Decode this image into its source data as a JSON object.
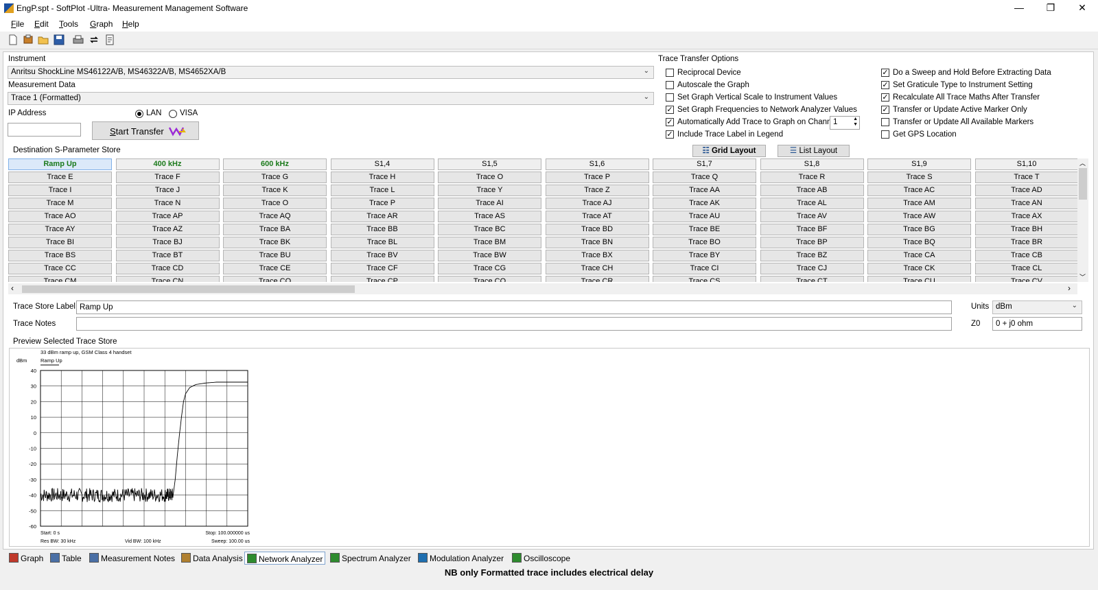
{
  "window": {
    "title": "EngP.spt - SoftPlot -Ultra- Measurement Management Software",
    "min": "—",
    "max": "❐",
    "close": "✕"
  },
  "menu": [
    {
      "u": "F",
      "rest": "ile"
    },
    {
      "u": "E",
      "rest": "dit"
    },
    {
      "u": "T",
      "rest": "ools"
    },
    {
      "u": "G",
      "rest": "raph"
    },
    {
      "u": "H",
      "rest": "elp"
    }
  ],
  "toolbar_icons": [
    "new-icon",
    "open-icon",
    "folder-icon",
    "save-icon",
    "print-icon",
    "refresh-icon",
    "script-icon"
  ],
  "instrument": {
    "label": "Instrument",
    "value": "Anritsu ShockLine MS46122A/B, MS46322A/B, MS4652XA/B",
    "measurement_label": "Measurement Data",
    "measurement_value": "Trace 1 (Formatted)",
    "ip_label": "IP Address",
    "ip_value": "",
    "lan": "LAN",
    "visa": "VISA",
    "transfer_btn": "Start Transfer",
    "transfer_btn_u": "S",
    "transfer_btn_rest": "tart Transfer"
  },
  "options": {
    "title": "Trace Transfer Options",
    "left": [
      {
        "label": "Reciprocal Device",
        "checked": false
      },
      {
        "label": "Autoscale the Graph",
        "checked": false
      },
      {
        "label": "Set Graph Vertical Scale to Instrument Values",
        "checked": false
      },
      {
        "label": "Set Graph Frequencies to Network Analyzer Values",
        "checked": true
      },
      {
        "label": "Automatically Add Trace to Graph on Channel",
        "checked": true
      },
      {
        "label": "Include Trace Label in Legend",
        "checked": true
      }
    ],
    "channel_value": "1",
    "right": [
      {
        "label": "Do a Sweep and Hold Before Extracting Data",
        "checked": true
      },
      {
        "label": "Set Graticule Type to Instrument Setting",
        "checked": true
      },
      {
        "label": "Recalculate All Trace Maths After Transfer",
        "checked": true
      },
      {
        "label": "Transfer or Update Active Marker Only",
        "checked": true
      },
      {
        "label": "Transfer or Update All Available Markers",
        "checked": false
      },
      {
        "label": "Get GPS Location",
        "checked": false
      }
    ]
  },
  "store": {
    "title": "Destination S-Parameter Store",
    "grid_layout": "Grid Layout",
    "list_layout": "List Layout",
    "headers": [
      "Ramp Up",
      "400 kHz",
      "600 kHz",
      "S1,4",
      "S1,5",
      "S1,6",
      "S1,7",
      "S1,8",
      "S1,9",
      "S1,10"
    ],
    "rows": [
      [
        "Trace E",
        "Trace F",
        "Trace G",
        "Trace H",
        "Trace O",
        "Trace P",
        "Trace Q",
        "Trace R",
        "Trace S",
        "Trace T"
      ],
      [
        "Trace I",
        "Trace J",
        "Trace K",
        "Trace L",
        "Trace Y",
        "Trace Z",
        "Trace AA",
        "Trace AB",
        "Trace AC",
        "Trace AD"
      ],
      [
        "Trace M",
        "Trace N",
        "Trace O",
        "Trace P",
        "Trace AI",
        "Trace AJ",
        "Trace AK",
        "Trace AL",
        "Trace AM",
        "Trace AN"
      ],
      [
        "Trace AO",
        "Trace AP",
        "Trace AQ",
        "Trace AR",
        "Trace AS",
        "Trace AT",
        "Trace AU",
        "Trace AV",
        "Trace AW",
        "Trace AX"
      ],
      [
        "Trace AY",
        "Trace AZ",
        "Trace BA",
        "Trace BB",
        "Trace BC",
        "Trace BD",
        "Trace BE",
        "Trace BF",
        "Trace BG",
        "Trace BH"
      ],
      [
        "Trace BI",
        "Trace BJ",
        "Trace BK",
        "Trace BL",
        "Trace BM",
        "Trace BN",
        "Trace BO",
        "Trace BP",
        "Trace BQ",
        "Trace BR"
      ],
      [
        "Trace BS",
        "Trace BT",
        "Trace BU",
        "Trace BV",
        "Trace BW",
        "Trace BX",
        "Trace BY",
        "Trace BZ",
        "Trace CA",
        "Trace CB"
      ],
      [
        "Trace CC",
        "Trace CD",
        "Trace CE",
        "Trace CF",
        "Trace CG",
        "Trace CH",
        "Trace CI",
        "Trace CJ",
        "Trace CK",
        "Trace CL"
      ],
      [
        "Trace CM",
        "Trace CN",
        "Trace CO",
        "Trace CP",
        "Trace CQ",
        "Trace CR",
        "Trace CS",
        "Trace CT",
        "Trace CU",
        "Trace CV"
      ]
    ]
  },
  "trace": {
    "label_caption": "Trace Store Label",
    "label_value": "Ramp Up",
    "notes_caption": "Trace Notes",
    "notes_value": "",
    "units_caption": "Units",
    "units_value": "dBm",
    "z0_caption": "Z0",
    "z0_value": "0 + j0 ohm"
  },
  "preview": {
    "title": "Preview Selected Trace Store",
    "chart_title": "33 dBm ramp up, GSM Class 4 handset",
    "legend": "Ramp Up",
    "yunit": "dBm",
    "start": "Start: 0 s",
    "stop": "Stop: 100.000000 us",
    "res_bw": "Res BW: 30 kHz",
    "vid_bw": "Vid BW: 100 kHz",
    "sweep": "Sweep: 100.00 us"
  },
  "chart_data": {
    "type": "line",
    "title": "33 dBm ramp up, GSM Class 4 handset",
    "ylabel": "dBm",
    "xlim": [
      0,
      100
    ],
    "ylim": [
      -60,
      40
    ],
    "yticks": [
      40,
      30,
      20,
      10,
      0,
      -10,
      -20,
      -30,
      -40,
      -50,
      -60
    ],
    "grid": true,
    "series": [
      {
        "name": "Ramp Up",
        "x": [
          0,
          10,
          20,
          30,
          40,
          50,
          60,
          64,
          65,
          66,
          67,
          68,
          69,
          70,
          72,
          75,
          80,
          85,
          90,
          95,
          100
        ],
        "y": [
          -40,
          -40,
          -40,
          -40,
          -40,
          -40,
          -40,
          -40,
          -30,
          -15,
          -2,
          10,
          20,
          25,
          29,
          31,
          32,
          32.5,
          32.5,
          32.5,
          32.5
        ]
      }
    ]
  },
  "tabs": [
    {
      "label": "Graph",
      "icon": "graph-icon",
      "color": "#c0392b"
    },
    {
      "label": "Table",
      "icon": "table-icon",
      "color": "#4a6fa5"
    },
    {
      "label": "Measurement Notes",
      "icon": "notes-icon",
      "color": "#4a6fa5"
    },
    {
      "label": "Data Analysis",
      "icon": "analysis-icon",
      "color": "#b08030"
    },
    {
      "label": "Network Analyzer",
      "icon": "network-analyzer-icon",
      "color": "#2e8b2e"
    },
    {
      "label": "Spectrum Analyzer",
      "icon": "spectrum-analyzer-icon",
      "color": "#2e8b2e"
    },
    {
      "label": "Modulation Analyzer",
      "icon": "modulation-analyzer-icon",
      "color": "#1f6fb0"
    },
    {
      "label": "Oscilloscope",
      "icon": "oscilloscope-icon",
      "color": "#2e8b2e"
    }
  ],
  "status": "NB only Formatted trace includes electrical delay"
}
